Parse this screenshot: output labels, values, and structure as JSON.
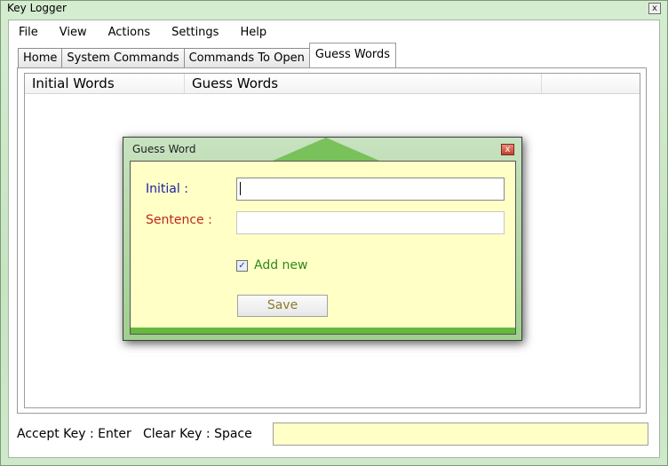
{
  "window": {
    "title": "Key Logger",
    "close_glyph": "x"
  },
  "menu": [
    "File",
    "View",
    "Actions",
    "Settings",
    "Help"
  ],
  "tabs": [
    {
      "label": "Home",
      "active": false
    },
    {
      "label": "System Commands",
      "active": false
    },
    {
      "label": "Commands To Open",
      "active": false
    },
    {
      "label": "Guess Words",
      "active": true
    }
  ],
  "list": {
    "columns": [
      "Initial Words",
      "Guess Words",
      ""
    ]
  },
  "status": {
    "accept_key": "Accept Key : Enter",
    "clear_key": "Clear Key : Space"
  },
  "dialog": {
    "title": "Guess Word",
    "close_glyph": "x",
    "initial_label": "Initial :",
    "initial_value": "",
    "sentence_label": "Sentence :",
    "sentence_value": "",
    "add_new_label": "Add new",
    "add_new_checked": true,
    "save_label": "Save"
  },
  "colors": {
    "initial_label": "#1b1fa3",
    "sentence_label": "#c0261e",
    "add_new_label": "#2d8a1a",
    "dialog_body": "#ffffc6",
    "status_box": "#ffffc6"
  }
}
